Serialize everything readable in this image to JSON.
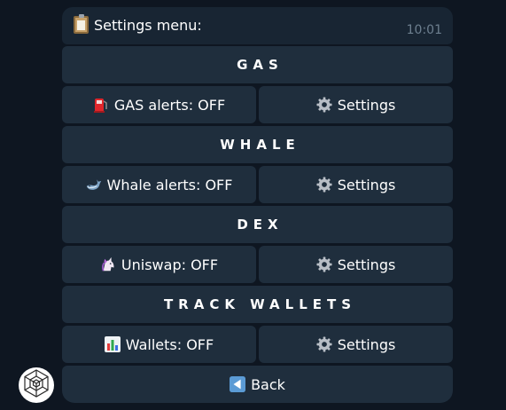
{
  "message": {
    "text": "Settings menu:",
    "time": "10:01",
    "icon": "clipboard-icon"
  },
  "keyboard": {
    "rows": [
      {
        "type": "header",
        "label": "GAS"
      },
      {
        "type": "pair",
        "left": {
          "icon": "fuel-pump-icon",
          "label": "GAS alerts: OFF"
        },
        "right": {
          "icon": "gear-icon",
          "label": "Settings"
        }
      },
      {
        "type": "header",
        "label": "WHALE"
      },
      {
        "type": "pair",
        "left": {
          "icon": "whale-icon",
          "label": "Whale alerts: OFF"
        },
        "right": {
          "icon": "gear-icon",
          "label": "Settings"
        }
      },
      {
        "type": "header",
        "label": "DEX"
      },
      {
        "type": "pair",
        "left": {
          "icon": "unicorn-icon",
          "label": "Uniswap: OFF"
        },
        "right": {
          "icon": "gear-icon",
          "label": "Settings"
        }
      },
      {
        "type": "header",
        "label": "TRACK WALLETS"
      },
      {
        "type": "pair",
        "left": {
          "icon": "bar-chart-icon",
          "label": "Wallets: OFF"
        },
        "right": {
          "icon": "gear-icon",
          "label": "Settings"
        }
      },
      {
        "type": "single",
        "icon": "back-arrow-icon",
        "label": "Back"
      }
    ]
  },
  "bot_avatar": {
    "icon": "cube-logo-icon"
  },
  "colors": {
    "background": "#0e1621",
    "bubble": "#182533",
    "button": "#1f2e3d",
    "text": "#ffffff",
    "time": "#6d7f8f"
  }
}
